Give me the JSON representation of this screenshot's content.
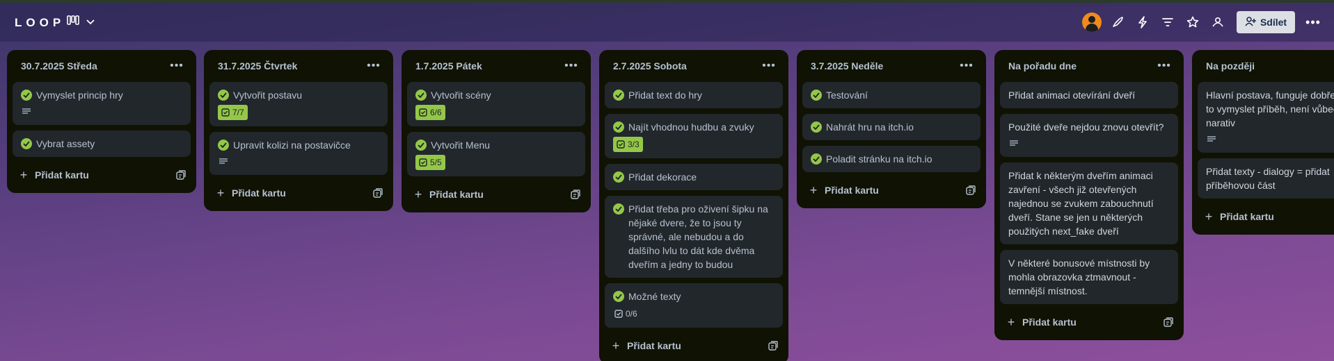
{
  "board": {
    "title": "LOOP",
    "share_label": "Sdílet"
  },
  "header_icons": [
    "view-switcher-icon",
    "chevron-down-icon",
    "member-avatar",
    "power-ups-icon",
    "automation-icon",
    "filter-icon",
    "star-icon",
    "visibility-icon",
    "add-member-icon",
    "more-icon"
  ],
  "accent_colors": {
    "check": "#94c748",
    "list_bg": "#101204",
    "card_bg": "#22272b",
    "share_bg": "#dcdfe4"
  },
  "add_card_label": "Přidat kartu",
  "lists": [
    {
      "title": "30.7.2025 Středa",
      "cards": [
        {
          "title": "Vymyslet princip hry",
          "done": true,
          "has_description": true
        },
        {
          "title": "Vybrat assety",
          "done": true
        }
      ]
    },
    {
      "title": "31.7.2025 Čtvrtek",
      "cards": [
        {
          "title": "Vytvořit postavu",
          "done": true,
          "checklist": "7/7",
          "checklist_complete": true
        },
        {
          "title": "Upravit kolizi na postavičce",
          "done": true,
          "has_description": true
        }
      ]
    },
    {
      "title": "1.7.2025 Pátek",
      "cards": [
        {
          "title": "Vytvořit scény",
          "done": true,
          "checklist": "6/6",
          "checklist_complete": true
        },
        {
          "title": "Vytvořit Menu",
          "done": true,
          "checklist": "5/5",
          "checklist_complete": true
        }
      ]
    },
    {
      "title": "2.7.2025 Sobota",
      "cards": [
        {
          "title": "Přidat text do hry",
          "done": true
        },
        {
          "title": "Najít vhodnou hudbu a zvuky",
          "done": true,
          "checklist": "3/3",
          "checklist_complete": true
        },
        {
          "title": "Přidat dekorace",
          "done": true
        },
        {
          "title": "Přidat třeba pro oživení šipku na nějaké dvere, že to jsou ty správné, ale nebudou a do dalšího lvlu to dát kde dvěma dveřím a jedny to budou",
          "done": true
        },
        {
          "title": "Možné texty",
          "done": true,
          "checklist": "0/6",
          "checklist_complete": false
        }
      ]
    },
    {
      "title": "3.7.2025 Neděle",
      "cards": [
        {
          "title": "Testování",
          "done": true
        },
        {
          "title": "Nahrát hru na itch.io",
          "done": true
        },
        {
          "title": "Poladit stránku na itch.io",
          "done": true
        }
      ]
    },
    {
      "title": "Na pořadu dne",
      "cards": [
        {
          "title": "Přidat animaci otevírání dveří",
          "done": false
        },
        {
          "title": "Použité dveře nejdou znovu otevřít?",
          "done": false,
          "has_description": true
        },
        {
          "title": "Přidat k některým dveřím animaci zavření - všech již otevřených najednou se zvukem zabouchnutí dveří. Stane se jen u některých použitých next_fake dveří",
          "done": false
        },
        {
          "title": "V některé bonusové místnosti by mohla obrazovka ztmavnout - temnější místnost.",
          "done": false
        }
      ]
    },
    {
      "title": "Na později",
      "cards": [
        {
          "title": "Hlavní postava, funguje dobře. Chce to vymyslet příběh, není vůbec narativ",
          "done": false,
          "has_description": true
        },
        {
          "title": "Přidat texty - dialogy = přidat příběhovou část",
          "done": false
        }
      ]
    }
  ]
}
